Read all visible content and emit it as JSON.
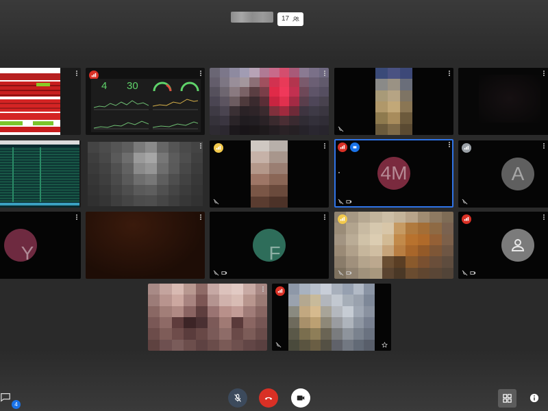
{
  "header": {
    "participant_count": "17",
    "people_icon": "people-icon"
  },
  "tiles": [
    {
      "id": "screen-share-dashboard-red",
      "type": "video"
    },
    {
      "id": "grafana-dashboard",
      "type": "video",
      "stats": [
        "4",
        "30"
      ],
      "badge": "red"
    },
    {
      "id": "participant-video-3",
      "type": "video"
    },
    {
      "id": "participant-video-4",
      "type": "video"
    },
    {
      "id": "participant-video-5",
      "type": "video"
    },
    {
      "id": "terminal-share",
      "type": "video"
    },
    {
      "id": "participant-video-7",
      "type": "video"
    },
    {
      "id": "participant-video-8",
      "type": "video",
      "badge": "yellow"
    },
    {
      "id": "participant-4m",
      "type": "avatar",
      "letter": "4M",
      "color": "#7a2a3e",
      "badge": "red",
      "badge2": "blue"
    },
    {
      "id": "participant-a",
      "type": "avatar",
      "letter": "A",
      "color": "#5f5f5f",
      "badge": "grey"
    },
    {
      "id": "participant-y",
      "type": "avatar",
      "letter": "Y",
      "color": "#6e2a40"
    },
    {
      "id": "participant-video-12",
      "type": "video"
    },
    {
      "id": "participant-f",
      "type": "avatar",
      "letter": "F",
      "color": "#2e6d5a"
    },
    {
      "id": "participant-video-14",
      "type": "video",
      "badge": "yellow"
    },
    {
      "id": "participant-anon",
      "type": "avatar",
      "letter": "",
      "color": "#7b7b7b",
      "badge": "red"
    },
    {
      "id": "participant-video-16",
      "type": "video"
    },
    {
      "id": "participant-video-17",
      "type": "video",
      "badge": "red"
    }
  ],
  "controls": {
    "chat_unread": "4",
    "mic": "mic-off-icon",
    "hangup": "hangup-icon",
    "camera": "camera-icon",
    "grid": "grid-icon",
    "info": "info-icon"
  },
  "colors": {
    "hangup": "#d93025",
    "mic_bg": "#3c4a5c",
    "accent": "#1a73e8",
    "active_border": "#2f74e7"
  }
}
